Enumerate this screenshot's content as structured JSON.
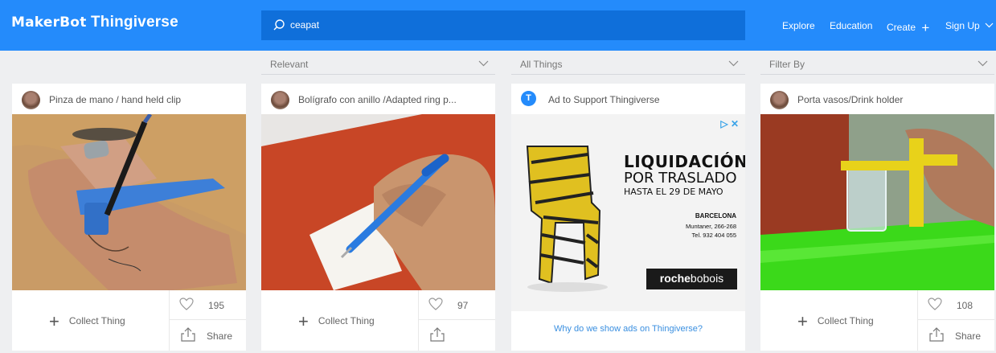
{
  "header": {
    "logo_maker": "MakerBot",
    "logo_name": "Thingiverse",
    "search_value": "ceapat",
    "nav": {
      "explore": "Explore",
      "education": "Education",
      "create": "Create",
      "signup": "Sign Up"
    }
  },
  "filters": {
    "sort": "Relevant",
    "type": "All Things",
    "filter": "Filter By"
  },
  "cards": [
    {
      "title": "Pinza de mano / hand held clip",
      "collect": "Collect Thing",
      "likes": "195",
      "share": "Share"
    },
    {
      "title": "Bolígrafo con anillo /Adapted ring p...",
      "collect": "Collect Thing",
      "likes": "97"
    },
    {
      "title": "Porta vasos/Drink holder",
      "collect": "Collect Thing",
      "likes": "108",
      "share": "Share"
    }
  ],
  "ad": {
    "title": "Ad to Support Thingiverse",
    "headline1": "LIQUIDACIÓN",
    "headline2": "POR TRASLADO",
    "headline3": "HASTA EL 29 DE MAYO",
    "city": "BARCELONA",
    "address1": "Muntaner, 266-268",
    "address2": "Tel. 932 404 055",
    "brand_bold": "roche",
    "brand_light": "bobois",
    "why_link": "Why do we show ads on Thingiverse?"
  },
  "colors": {
    "brand": "#248bfb",
    "search_bg": "#0f6fda",
    "page_bg": "#eeeff1",
    "link": "#3a8fe0"
  }
}
